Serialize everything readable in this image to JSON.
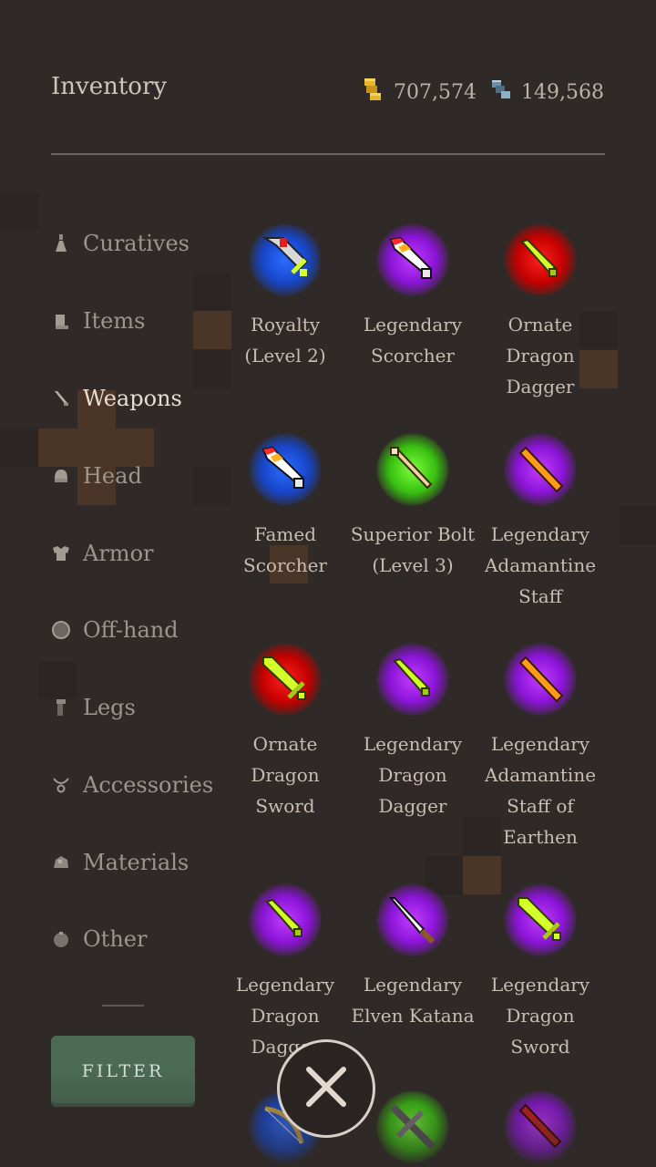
{
  "header": {
    "title": "Inventory",
    "gold": "707,574",
    "gems": "149,568",
    "gold_icon": "gold-coins-icon",
    "gems_icon": "gem-stack-icon"
  },
  "sidebar": {
    "active": "Weapons",
    "categories": [
      {
        "label": "Curatives",
        "icon": "potion-flask-icon"
      },
      {
        "label": "Items",
        "icon": "item-bag-icon"
      },
      {
        "label": "Weapons",
        "icon": "sword-icon"
      },
      {
        "label": "Head",
        "icon": "helmet-icon"
      },
      {
        "label": "Armor",
        "icon": "chest-armor-icon"
      },
      {
        "label": "Off-hand",
        "icon": "shield-icon"
      },
      {
        "label": "Legs",
        "icon": "leg-armor-icon"
      },
      {
        "label": "Accessories",
        "icon": "necklace-icon"
      },
      {
        "label": "Materials",
        "icon": "ore-icon"
      },
      {
        "label": "Other",
        "icon": "misc-orb-icon"
      }
    ],
    "filter_label": "FILTER"
  },
  "items": [
    {
      "name": "Royalty (Level 2)",
      "lines": [
        "Royalty",
        "(Level 2)"
      ],
      "rarity_color": "#1746c8",
      "icon": "broadsword-icon"
    },
    {
      "name": "Legendary Scorcher",
      "lines": [
        "Legendary",
        "Scorcher"
      ],
      "rarity_color": "#8a14d6",
      "icon": "flame-sword-icon"
    },
    {
      "name": "Ornate Dragon Dagger",
      "lines": [
        "Ornate",
        "Dragon",
        "Dagger"
      ],
      "rarity_color": "#c40000",
      "icon": "dagger-icon"
    },
    {
      "name": "Famed Scorcher",
      "lines": [
        "Famed",
        "Scorcher"
      ],
      "rarity_color": "#1746c8",
      "icon": "flame-sword-icon"
    },
    {
      "name": "Superior Bolt (Level 3)",
      "lines": [
        "Superior Bolt",
        "(Level 3)"
      ],
      "rarity_color": "#38c010",
      "icon": "bolt-icon"
    },
    {
      "name": "Legendary Adamantine Staff",
      "lines": [
        "Legendary",
        "Adamantine",
        "Staff"
      ],
      "rarity_color": "#8a14d6",
      "icon": "staff-icon"
    },
    {
      "name": "Ornate Dragon Sword",
      "lines": [
        "Ornate",
        "Dragon",
        "Sword"
      ],
      "rarity_color": "#c40000",
      "icon": "sword-icon"
    },
    {
      "name": "Legendary Dragon Dagger",
      "lines": [
        "Legendary",
        "Dragon",
        "Dagger"
      ],
      "rarity_color": "#8a14d6",
      "icon": "dagger-icon"
    },
    {
      "name": "Legendary Adamantine Staff of Earthen",
      "lines": [
        "Legendary",
        "Adamantine",
        "Staff of",
        "Earthen"
      ],
      "rarity_color": "#8a14d6",
      "icon": "staff-icon"
    },
    {
      "name": "Legendary Dragon Dagger",
      "lines": [
        "Legendary",
        "Dragon",
        "Dagger"
      ],
      "rarity_color": "#8a14d6",
      "icon": "dagger-icon"
    },
    {
      "name": "Legendary Elven Katana",
      "lines": [
        "Legendary",
        "Elven Katana"
      ],
      "rarity_color": "#8a14d6",
      "icon": "katana-icon"
    },
    {
      "name": "Legendary Dragon Sword",
      "lines": [
        "Legendary",
        "Dragon",
        "Sword"
      ],
      "rarity_color": "#8a14d6",
      "icon": "sword-icon"
    },
    {
      "name": "",
      "lines": [],
      "rarity_color": "#1746c8",
      "icon": "bow-icon"
    },
    {
      "name": "",
      "lines": [],
      "rarity_color": "#38c010",
      "icon": "crossbow-icon"
    },
    {
      "name": "",
      "lines": [],
      "rarity_color": "#8a14d6",
      "icon": "red-blade-icon"
    }
  ],
  "close_icon": "close-icon"
}
